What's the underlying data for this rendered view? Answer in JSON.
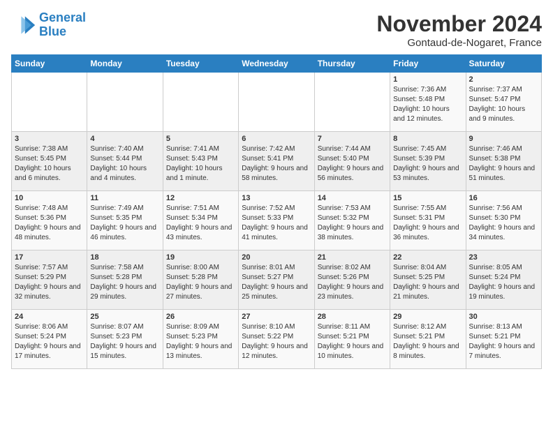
{
  "header": {
    "logo_line1": "General",
    "logo_line2": "Blue",
    "month": "November 2024",
    "location": "Gontaud-de-Nogaret, France"
  },
  "days_of_week": [
    "Sunday",
    "Monday",
    "Tuesday",
    "Wednesday",
    "Thursday",
    "Friday",
    "Saturday"
  ],
  "weeks": [
    [
      {
        "day": "",
        "info": ""
      },
      {
        "day": "",
        "info": ""
      },
      {
        "day": "",
        "info": ""
      },
      {
        "day": "",
        "info": ""
      },
      {
        "day": "",
        "info": ""
      },
      {
        "day": "1",
        "info": "Sunrise: 7:36 AM\nSunset: 5:48 PM\nDaylight: 10 hours and 12 minutes."
      },
      {
        "day": "2",
        "info": "Sunrise: 7:37 AM\nSunset: 5:47 PM\nDaylight: 10 hours and 9 minutes."
      }
    ],
    [
      {
        "day": "3",
        "info": "Sunrise: 7:38 AM\nSunset: 5:45 PM\nDaylight: 10 hours and 6 minutes."
      },
      {
        "day": "4",
        "info": "Sunrise: 7:40 AM\nSunset: 5:44 PM\nDaylight: 10 hours and 4 minutes."
      },
      {
        "day": "5",
        "info": "Sunrise: 7:41 AM\nSunset: 5:43 PM\nDaylight: 10 hours and 1 minute."
      },
      {
        "day": "6",
        "info": "Sunrise: 7:42 AM\nSunset: 5:41 PM\nDaylight: 9 hours and 58 minutes."
      },
      {
        "day": "7",
        "info": "Sunrise: 7:44 AM\nSunset: 5:40 PM\nDaylight: 9 hours and 56 minutes."
      },
      {
        "day": "8",
        "info": "Sunrise: 7:45 AM\nSunset: 5:39 PM\nDaylight: 9 hours and 53 minutes."
      },
      {
        "day": "9",
        "info": "Sunrise: 7:46 AM\nSunset: 5:38 PM\nDaylight: 9 hours and 51 minutes."
      }
    ],
    [
      {
        "day": "10",
        "info": "Sunrise: 7:48 AM\nSunset: 5:36 PM\nDaylight: 9 hours and 48 minutes."
      },
      {
        "day": "11",
        "info": "Sunrise: 7:49 AM\nSunset: 5:35 PM\nDaylight: 9 hours and 46 minutes."
      },
      {
        "day": "12",
        "info": "Sunrise: 7:51 AM\nSunset: 5:34 PM\nDaylight: 9 hours and 43 minutes."
      },
      {
        "day": "13",
        "info": "Sunrise: 7:52 AM\nSunset: 5:33 PM\nDaylight: 9 hours and 41 minutes."
      },
      {
        "day": "14",
        "info": "Sunrise: 7:53 AM\nSunset: 5:32 PM\nDaylight: 9 hours and 38 minutes."
      },
      {
        "day": "15",
        "info": "Sunrise: 7:55 AM\nSunset: 5:31 PM\nDaylight: 9 hours and 36 minutes."
      },
      {
        "day": "16",
        "info": "Sunrise: 7:56 AM\nSunset: 5:30 PM\nDaylight: 9 hours and 34 minutes."
      }
    ],
    [
      {
        "day": "17",
        "info": "Sunrise: 7:57 AM\nSunset: 5:29 PM\nDaylight: 9 hours and 32 minutes."
      },
      {
        "day": "18",
        "info": "Sunrise: 7:58 AM\nSunset: 5:28 PM\nDaylight: 9 hours and 29 minutes."
      },
      {
        "day": "19",
        "info": "Sunrise: 8:00 AM\nSunset: 5:28 PM\nDaylight: 9 hours and 27 minutes."
      },
      {
        "day": "20",
        "info": "Sunrise: 8:01 AM\nSunset: 5:27 PM\nDaylight: 9 hours and 25 minutes."
      },
      {
        "day": "21",
        "info": "Sunrise: 8:02 AM\nSunset: 5:26 PM\nDaylight: 9 hours and 23 minutes."
      },
      {
        "day": "22",
        "info": "Sunrise: 8:04 AM\nSunset: 5:25 PM\nDaylight: 9 hours and 21 minutes."
      },
      {
        "day": "23",
        "info": "Sunrise: 8:05 AM\nSunset: 5:24 PM\nDaylight: 9 hours and 19 minutes."
      }
    ],
    [
      {
        "day": "24",
        "info": "Sunrise: 8:06 AM\nSunset: 5:24 PM\nDaylight: 9 hours and 17 minutes."
      },
      {
        "day": "25",
        "info": "Sunrise: 8:07 AM\nSunset: 5:23 PM\nDaylight: 9 hours and 15 minutes."
      },
      {
        "day": "26",
        "info": "Sunrise: 8:09 AM\nSunset: 5:23 PM\nDaylight: 9 hours and 13 minutes."
      },
      {
        "day": "27",
        "info": "Sunrise: 8:10 AM\nSunset: 5:22 PM\nDaylight: 9 hours and 12 minutes."
      },
      {
        "day": "28",
        "info": "Sunrise: 8:11 AM\nSunset: 5:21 PM\nDaylight: 9 hours and 10 minutes."
      },
      {
        "day": "29",
        "info": "Sunrise: 8:12 AM\nSunset: 5:21 PM\nDaylight: 9 hours and 8 minutes."
      },
      {
        "day": "30",
        "info": "Sunrise: 8:13 AM\nSunset: 5:21 PM\nDaylight: 9 hours and 7 minutes."
      }
    ]
  ]
}
